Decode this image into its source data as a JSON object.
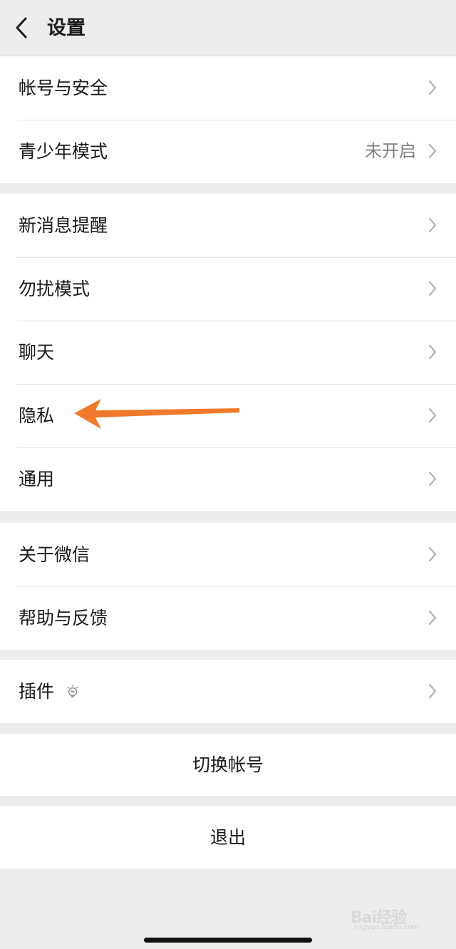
{
  "header": {
    "title": "设置"
  },
  "group1": {
    "account_security": "帐号与安全",
    "teen_mode": "青少年模式",
    "teen_mode_status": "未开启"
  },
  "group2": {
    "notifications": "新消息提醒",
    "do_not_disturb": "勿扰模式",
    "chat": "聊天",
    "privacy": "隐私",
    "general": "通用"
  },
  "group3": {
    "about": "关于微信",
    "help_feedback": "帮助与反馈"
  },
  "group4": {
    "plugins": "插件"
  },
  "actions": {
    "switch_account": "切换帐号",
    "logout": "退出"
  },
  "watermark": {
    "brand": "Bai经验",
    "url": "jingyan.baidu.com"
  },
  "colors": {
    "accent_arrow": "#f07a2c",
    "background": "#ededed"
  },
  "icons": [
    "back-chevron-icon",
    "chevron-right-icon",
    "lightbulb-icon",
    "arrow-annotation"
  ]
}
